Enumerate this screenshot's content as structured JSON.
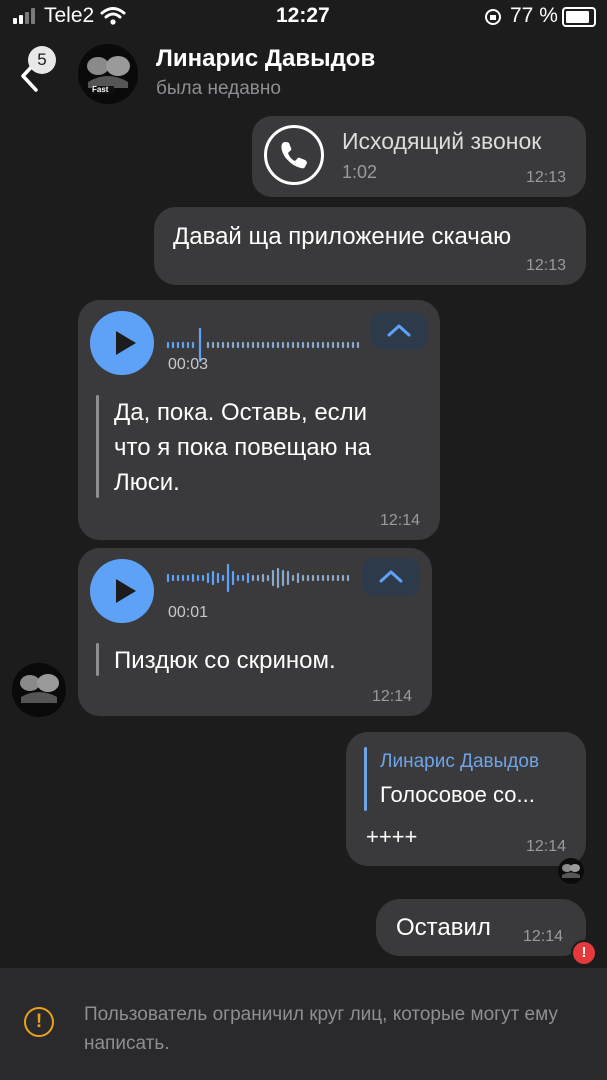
{
  "status_bar": {
    "carrier": "Tele2",
    "time": "12:27",
    "battery": "77 %",
    "icons": [
      "signal-icon",
      "wifi-icon",
      "orientation-lock-icon",
      "battery-icon"
    ]
  },
  "header": {
    "back_badge": "5",
    "contact_name": "Линарис Давыдов",
    "contact_status": "была недавно",
    "avatar_label": "Fast"
  },
  "messages": [
    {
      "kind": "call",
      "title": "Исходящий звонок",
      "duration": "1:02",
      "time": "12:13",
      "direction": "outgoing",
      "icon": "phone-icon"
    },
    {
      "kind": "text",
      "text": "Давай ща приложение скачаю",
      "time": "12:13",
      "direction": "outgoing"
    },
    {
      "kind": "voice",
      "duration": "00:03",
      "lines": [
        "Да, пока. Оставь, если",
        "что я пока повещаю на",
        "Люси."
      ],
      "time": "12:14",
      "direction": "incoming"
    },
    {
      "kind": "voice",
      "duration": "00:01",
      "lines": [
        "Пиздюк со скрином."
      ],
      "time": "12:14",
      "direction": "incoming"
    },
    {
      "kind": "reply",
      "reply_author": "Линарис Давыдов",
      "reply_preview": "Голосовое со...",
      "text": "++++",
      "time": "12:14",
      "direction": "outgoing"
    },
    {
      "kind": "text",
      "text": "Оставил",
      "time": "12:14",
      "direction": "outgoing",
      "status": "error"
    }
  ],
  "footer": {
    "notice": "Пользователь ограничил круг лиц, которые могут ему написать.",
    "icon": "warning-icon"
  },
  "colors": {
    "background": "#1c1c1d",
    "bubble": "#3a3a3c",
    "accent": "#5ea2f7",
    "reply_author": "#6ea4e6",
    "warning": "#e6a21c",
    "error": "#e5393c"
  }
}
